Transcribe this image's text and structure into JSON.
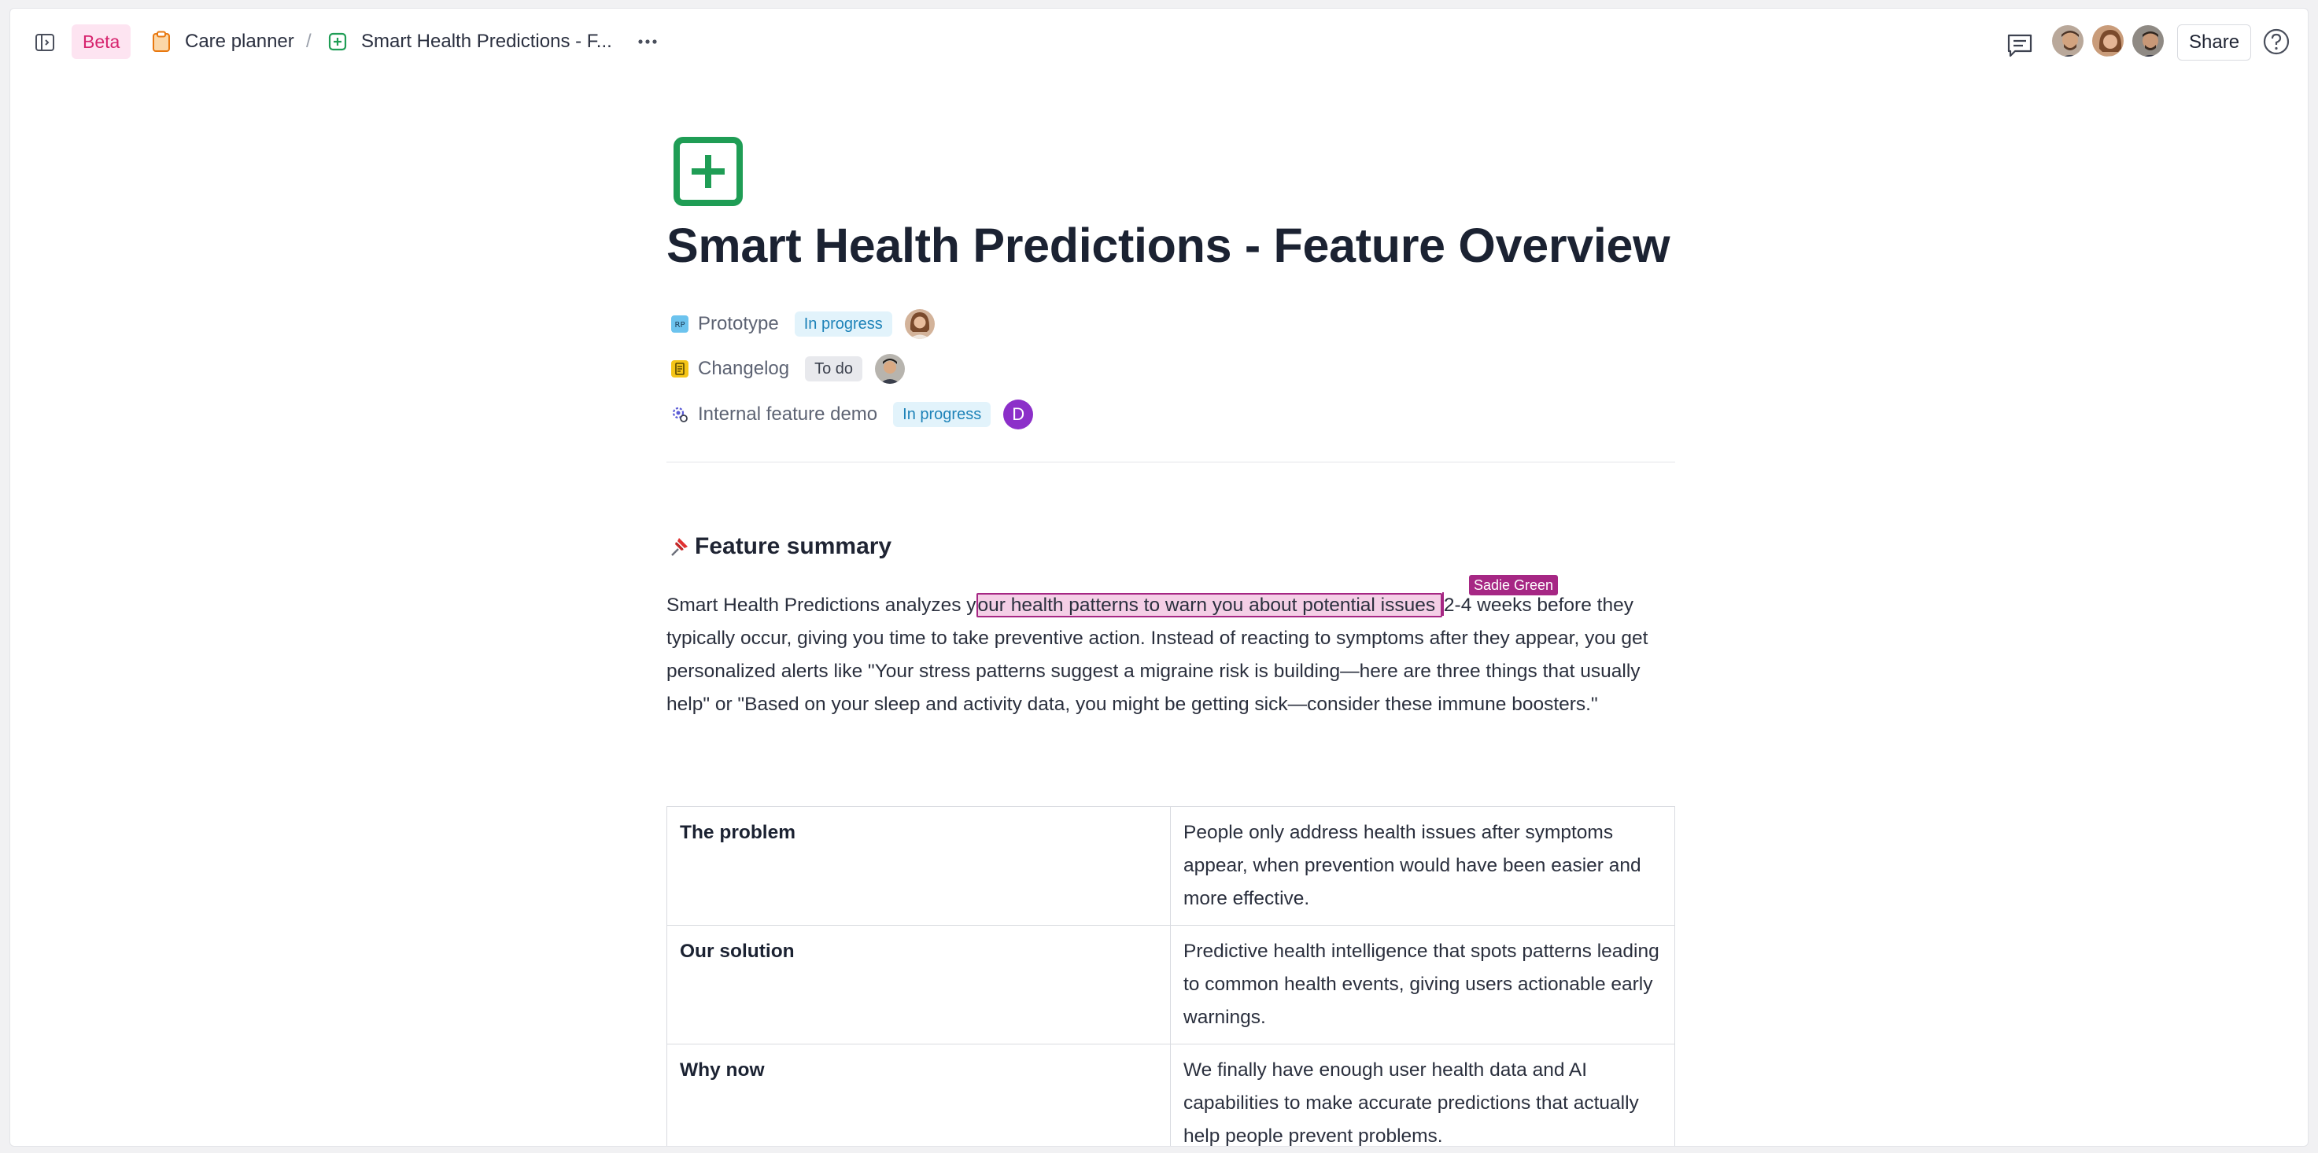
{
  "topbar": {
    "beta_label": "Beta",
    "breadcrumbs": [
      {
        "label": "Care planner",
        "icon": "clipboard-icon"
      },
      {
        "label": "Smart Health Predictions - F...",
        "icon": "plus-square-icon"
      }
    ],
    "separator": "/",
    "share_label": "Share"
  },
  "page": {
    "icon": "plus-square-icon",
    "icon_color": "#1f9d55",
    "title": "Smart Health Predictions - Feature Overview"
  },
  "properties": [
    {
      "label": "Prototype",
      "badge": "RP",
      "status": "In progress",
      "assignee": "woman avatar"
    },
    {
      "label": "Changelog",
      "status": "To do",
      "assignee": "man avatar"
    },
    {
      "label": "Internal feature demo",
      "status": "In progress",
      "assignee_initial": "D"
    }
  ],
  "section": {
    "heading": "Feature summary",
    "paragraph_before": "Smart Health Predictions analyzes y",
    "paragraph_highlight": "our health patterns to warn you about potential issues ",
    "paragraph_after": "2-4 weeks before they typically occur, giving you time to take preventive action. Instead of reacting to symptoms after they appear, you get personalized alerts like \"Your stress patterns suggest a migraine risk is building—here are three things that usually help\" or \"Based on your sleep and activity data, you might be getting sick—consider these immune boosters.\"",
    "collaborator": "Sadie Green"
  },
  "table": [
    {
      "key": "The problem",
      "value": "People only address health issues after symptoms appear, when prevention would have been easier and more effective."
    },
    {
      "key": "Our solution",
      "value": "Predictive health intelligence that spots patterns leading to common health events, giving users actionable early warnings."
    },
    {
      "key": "Why now",
      "value": "We finally have enough user health data and AI capabilities to make accurate predictions that actually help people prevent problems."
    }
  ],
  "colors": {
    "accent_green": "#1f9d55",
    "beta_pink": "#d6246e",
    "collab_magenta": "#a62784",
    "status_blue": "#1d82b8"
  }
}
